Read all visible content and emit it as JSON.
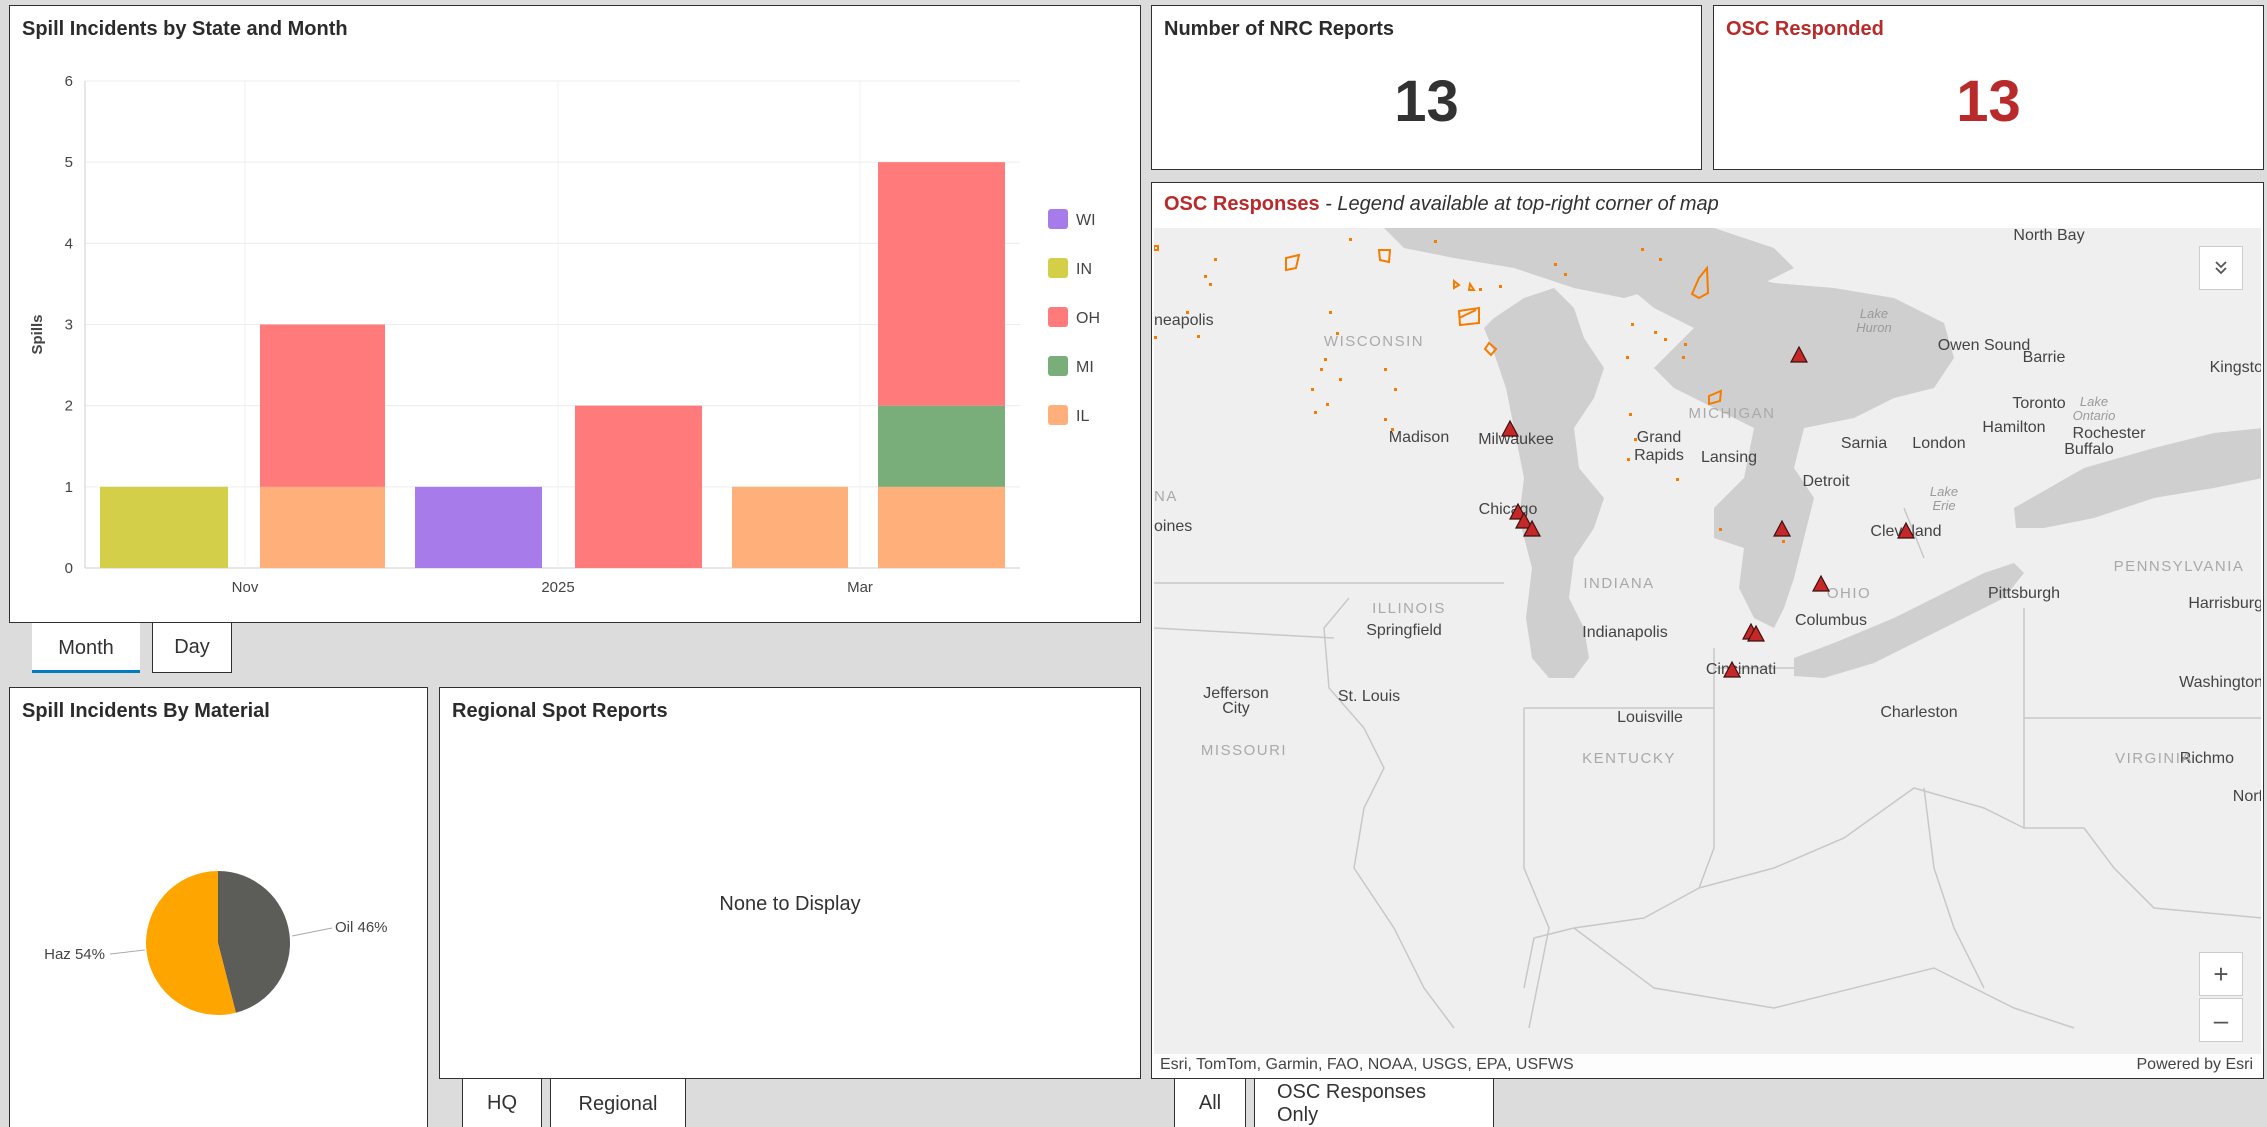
{
  "state_month_chart": {
    "title": "Spill Incidents by State and Month",
    "tabs": [
      "Month",
      "Day"
    ],
    "active_tab": "Month",
    "chart_data": {
      "type": "bar",
      "stacked": true,
      "ylabel": "Spills",
      "ylim": [
        0,
        6
      ],
      "y_ticks": [
        0,
        1,
        2,
        3,
        4,
        5,
        6
      ],
      "x_tick_labels": [
        "Nov",
        "2025",
        "Mar"
      ],
      "grid": true,
      "legend_placement": "right",
      "series_colors": {
        "WI": "#a77bea",
        "IN": "#d4cf48",
        "OH": "#ff7a7a",
        "MI": "#79ae7a",
        "IL": "#ffaf7a"
      },
      "legend": [
        "WI",
        "IN",
        "OH",
        "MI",
        "IL"
      ],
      "bars": [
        {
          "IN": 1
        },
        {
          "IL": 1,
          "OH": 2
        },
        {
          "WI": 1
        },
        {
          "OH": 2
        },
        {
          "IL": 1
        },
        {
          "IL": 1,
          "MI": 1,
          "OH": 3
        }
      ]
    }
  },
  "nrc_reports": {
    "title": "Number of NRC Reports",
    "value": "13"
  },
  "osc_responded": {
    "title": "OSC Responded",
    "value": "13",
    "color": "#b92a2a"
  },
  "material_chart": {
    "title": "Spill Incidents By Material",
    "chart_data": {
      "type": "pie",
      "slices": [
        {
          "label": "Oil 46%",
          "value": 46,
          "color": "#5c5c58"
        },
        {
          "label": "Haz 54%",
          "value": 54,
          "color": "#ffa500"
        }
      ]
    }
  },
  "spot_reports": {
    "title": "Regional Spot Reports",
    "empty_text": "None to Display",
    "tabs": [
      "HQ",
      "Regional"
    ],
    "active_tab": "Regional"
  },
  "map": {
    "title_strong": "OSC Responses",
    "title_rest": " - Legend available at top-right corner of map",
    "attribution": "Esri, TomTom, Garmin, FAO, NOAA, USGS, EPA, USFWS",
    "powered_by": "Powered by Esri",
    "tabs": [
      "All",
      "OSC Responses Only"
    ],
    "active_tab": "OSC Responses Only",
    "zoom_in": "+",
    "zoom_out": "–",
    "expand_icon": "chevrons-down-icon",
    "marker_color": "#c62828",
    "outline_color": "#f57c00",
    "cities": [
      "North Bay",
      "neapolis",
      "Owen Sound",
      "Barrie",
      "Kingsto",
      "Toronto",
      "Hamilton",
      "Rochester",
      "Buffalo",
      "Madison",
      "Milwaukee",
      "Grand",
      "Rapids",
      "Lansing",
      "Sarnia",
      "London",
      "Detroit",
      "Chicago",
      "oines",
      "Cleveland",
      "Pittsburgh",
      "Harrisburg",
      "Columbus",
      "Indianapolis",
      "Springfield",
      "Cincinnati",
      "Jefferson",
      "City",
      "St. Louis",
      "Louisville",
      "Charleston",
      "Washington",
      "Richmo",
      "Norf"
    ],
    "states": [
      "WISCONSIN",
      "MICHIGAN",
      "ILLINOIS",
      "INDIANA",
      "OHIO",
      "PENNSYLVANIA",
      "MISSOURI",
      "KENTUCKY",
      "VIRGINIA",
      "NA"
    ],
    "waters": [
      "Lake",
      "Huron",
      "Lake",
      "Ontario",
      "Lake",
      "Erie"
    ]
  }
}
